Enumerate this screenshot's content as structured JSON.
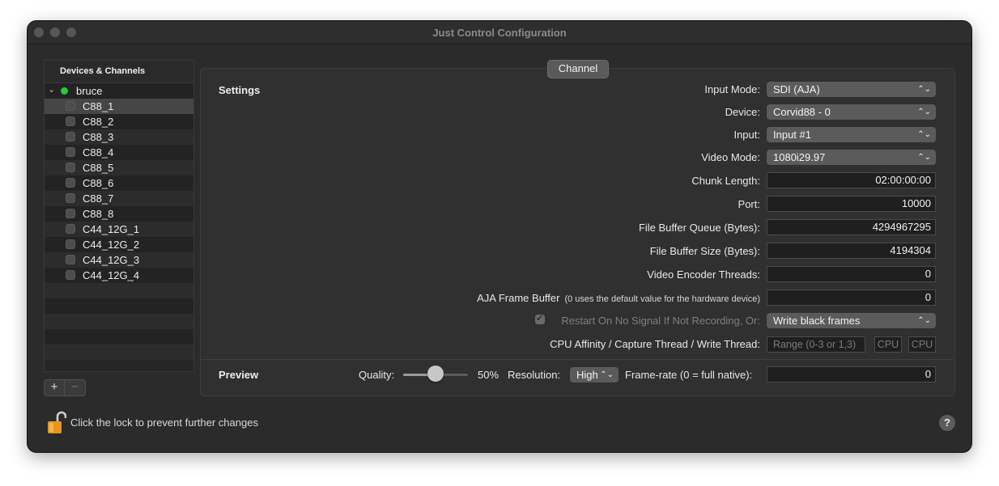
{
  "window": {
    "title": "Just Control Configuration"
  },
  "sidebar": {
    "header": "Devices & Channels",
    "device": {
      "name": "bruce",
      "status_color": "#27c93f"
    },
    "channels": [
      "C88_1",
      "C88_2",
      "C88_3",
      "C88_4",
      "C88_5",
      "C88_6",
      "C88_7",
      "C88_8",
      "C44_12G_1",
      "C44_12G_2",
      "C44_12G_3",
      "C44_12G_4"
    ],
    "selected": "C88_1",
    "add_label": "+",
    "remove_label": "−"
  },
  "tab": {
    "label": "Channel"
  },
  "settings": {
    "section_label": "Settings",
    "input_mode": {
      "label": "Input Mode:",
      "value": "SDI (AJA)"
    },
    "device": {
      "label": "Device:",
      "value": "Corvid88 - 0"
    },
    "input": {
      "label": "Input:",
      "value": "Input #1"
    },
    "video_mode": {
      "label": "Video Mode:",
      "value": "1080i29.97"
    },
    "chunk_length": {
      "label": "Chunk Length:",
      "value": "02:00:00:00"
    },
    "port": {
      "label": "Port:",
      "value": "10000"
    },
    "file_buffer_queue": {
      "label": "File Buffer Queue (Bytes):",
      "value": "4294967295"
    },
    "file_buffer_size": {
      "label": "File Buffer Size (Bytes):",
      "value": "4194304"
    },
    "video_encoder_threads": {
      "label": "Video Encoder Threads:",
      "value": "0"
    },
    "aja_frame_buffer": {
      "label": "AJA Frame Buffer",
      "hint": "(0 uses the default value for the hardware device)",
      "value": "0"
    },
    "restart_on_no_signal": {
      "label": "Restart On No Signal If Not Recording, Or:",
      "checked": true,
      "value": "Write black frames"
    },
    "cpu_affinity": {
      "label": "CPU Affinity / Capture Thread / Write Thread:",
      "placeholder": "Range (0-3 or 1,3)",
      "capture_placeholder": "CPU",
      "write_placeholder": "CPU"
    }
  },
  "preview": {
    "section_label": "Preview",
    "quality_label": "Quality:",
    "quality_value": 50,
    "quality_text": "50%",
    "resolution_label": "Resolution:",
    "resolution_value": "High",
    "framerate_label": "Frame-rate (0 = full native):",
    "framerate_value": "0"
  },
  "footer": {
    "lock_text": "Click the lock to prevent further changes",
    "help_label": "?"
  },
  "icons": {
    "lock": "lock-open-icon",
    "help": "help-icon",
    "chevron": "chevron-down-icon",
    "popup_arrows": "updown-arrows-icon"
  }
}
